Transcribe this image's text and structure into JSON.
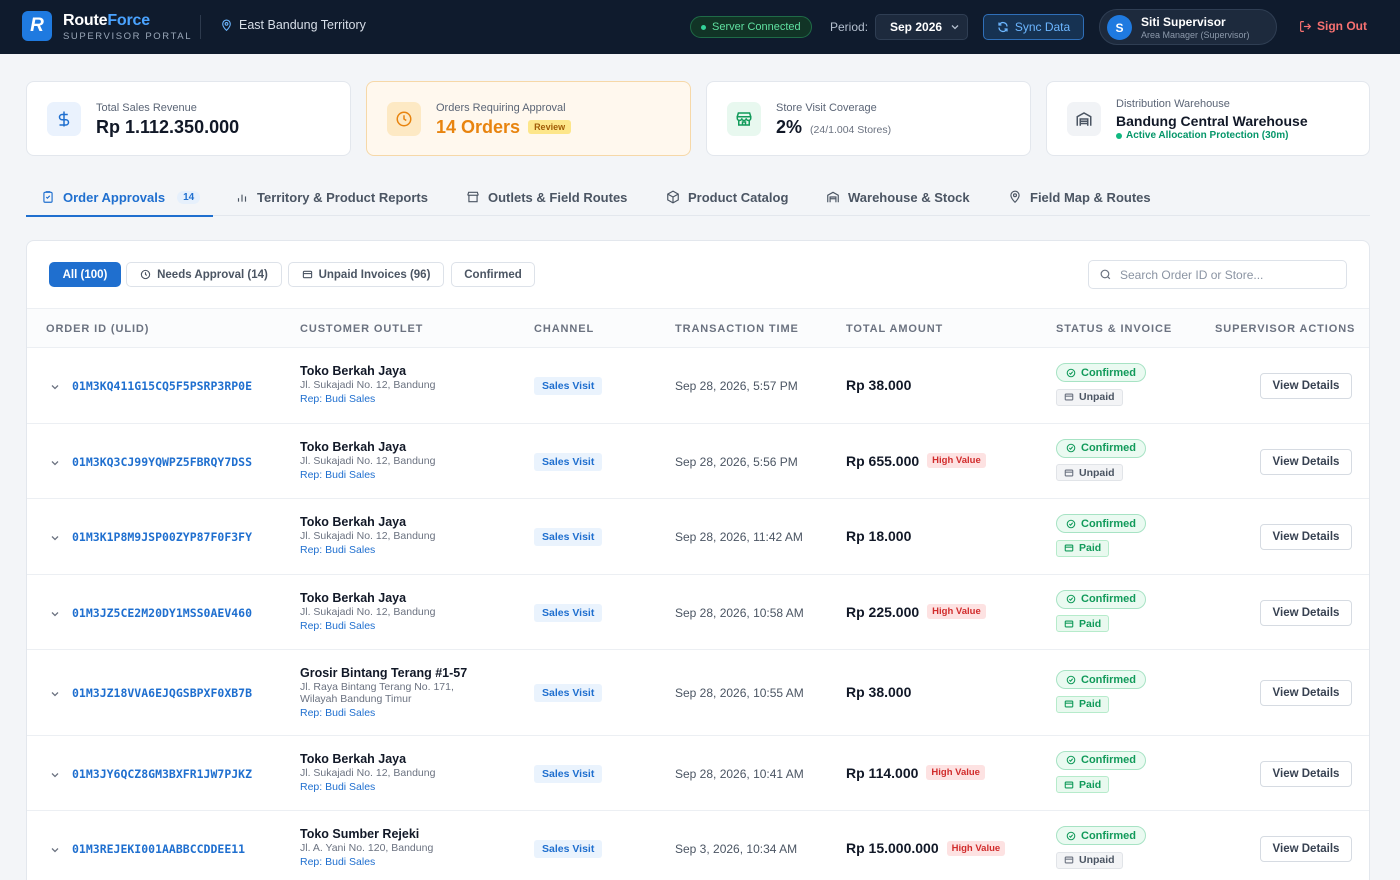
{
  "header": {
    "logo_letter": "R",
    "brand_main": "Route",
    "brand_accent": "Force",
    "brand_sub": "SUPERVISOR PORTAL",
    "territory": "East Bandung Territory",
    "server_status": "Server Connected",
    "period_label": "Period:",
    "period_value": "Sep 2026",
    "sync_label": "Sync Data",
    "user_initial": "S",
    "user_name": "Siti Supervisor",
    "user_role": "Area Manager (Supervisor)",
    "signout_label": "Sign Out"
  },
  "stats": {
    "revenue_label": "Total Sales Revenue",
    "revenue_value": "Rp 1.112.350.000",
    "approval_label": "Orders Requiring Approval",
    "approval_value": "14 Orders",
    "approval_badge": "Review",
    "coverage_label": "Store Visit Coverage",
    "coverage_value": "2%",
    "coverage_detail": "(24/1.004 Stores)",
    "warehouse_label": "Distribution Warehouse",
    "warehouse_value": "Bandung Central Warehouse",
    "warehouse_status": "Active Allocation Protection (30m)"
  },
  "tabs": [
    {
      "label": "Order Approvals",
      "count": "14"
    },
    {
      "label": "Territory & Product Reports"
    },
    {
      "label": "Outlets & Field Routes"
    },
    {
      "label": "Product Catalog"
    },
    {
      "label": "Warehouse & Stock"
    },
    {
      "label": "Field Map & Routes"
    }
  ],
  "filters": {
    "all": "All (100)",
    "needs_approval": "Needs Approval (14)",
    "unpaid": "Unpaid Invoices (96)",
    "confirmed": "Confirmed"
  },
  "search": {
    "placeholder": "Search Order ID or Store..."
  },
  "columns": [
    "ORDER ID (ULID)",
    "CUSTOMER OUTLET",
    "CHANNEL",
    "TRANSACTION TIME",
    "TOTAL AMOUNT",
    "STATUS & INVOICE",
    "SUPERVISOR ACTIONS"
  ],
  "orders": [
    {
      "id": "01M3KQ411G15CQ5F5PSRP3RP0E",
      "outlet": "Toko Berkah Jaya",
      "address": "Jl. Sukajadi No. 12, Bandung",
      "rep": "Rep: Budi Sales",
      "channel": "Sales Visit",
      "time": "Sep 28, 2026, 5:57 PM",
      "amount": "Rp 38.000",
      "high_value": "",
      "status": "Confirmed",
      "invoice": "Unpaid",
      "action": "View Details"
    },
    {
      "id": "01M3KQ3CJ99YQWPZ5FBRQY7DSS",
      "outlet": "Toko Berkah Jaya",
      "address": "Jl. Sukajadi No. 12, Bandung",
      "rep": "Rep: Budi Sales",
      "channel": "Sales Visit",
      "time": "Sep 28, 2026, 5:56 PM",
      "amount": "Rp 655.000",
      "high_value": "High Value",
      "status": "Confirmed",
      "invoice": "Unpaid",
      "action": "View Details"
    },
    {
      "id": "01M3K1P8M9JSP00ZYP87F0F3FY",
      "outlet": "Toko Berkah Jaya",
      "address": "Jl. Sukajadi No. 12, Bandung",
      "rep": "Rep: Budi Sales",
      "channel": "Sales Visit",
      "time": "Sep 28, 2026, 11:42 AM",
      "amount": "Rp 18.000",
      "high_value": "",
      "status": "Confirmed",
      "invoice": "Paid",
      "action": "View Details"
    },
    {
      "id": "01M3JZ5CE2M20DY1MSS0AEV460",
      "outlet": "Toko Berkah Jaya",
      "address": "Jl. Sukajadi No. 12, Bandung",
      "rep": "Rep: Budi Sales",
      "channel": "Sales Visit",
      "time": "Sep 28, 2026, 10:58 AM",
      "amount": "Rp 225.000",
      "high_value": "High Value",
      "status": "Confirmed",
      "invoice": "Paid",
      "action": "View Details"
    },
    {
      "id": "01M3JZ18VVA6EJQGSBPXF0XB7B",
      "outlet": "Grosir Bintang Terang #1-57",
      "address": "Jl. Raya Bintang Terang No. 171, Wilayah Bandung Timur",
      "rep": "Rep: Budi Sales",
      "channel": "Sales Visit",
      "time": "Sep 28, 2026, 10:55 AM",
      "amount": "Rp 38.000",
      "high_value": "",
      "status": "Confirmed",
      "invoice": "Paid",
      "action": "View Details"
    },
    {
      "id": "01M3JY6QCZ8GM3BXFR1JW7PJKZ",
      "outlet": "Toko Berkah Jaya",
      "address": "Jl. Sukajadi No. 12, Bandung",
      "rep": "Rep: Budi Sales",
      "channel": "Sales Visit",
      "time": "Sep 28, 2026, 10:41 AM",
      "amount": "Rp 114.000",
      "high_value": "High Value",
      "status": "Confirmed",
      "invoice": "Paid",
      "action": "View Details"
    },
    {
      "id": "01M3REJEKI001AABBCCDDEE11",
      "outlet": "Toko Sumber Rejeki",
      "address": "Jl. A. Yani No. 120, Bandung",
      "rep": "Rep: Budi Sales",
      "channel": "Sales Visit",
      "time": "Sep 3, 2026, 10:34 AM",
      "amount": "Rp 15.000.000",
      "high_value": "High Value",
      "status": "Confirmed",
      "invoice": "Unpaid",
      "action": "View Details"
    }
  ]
}
